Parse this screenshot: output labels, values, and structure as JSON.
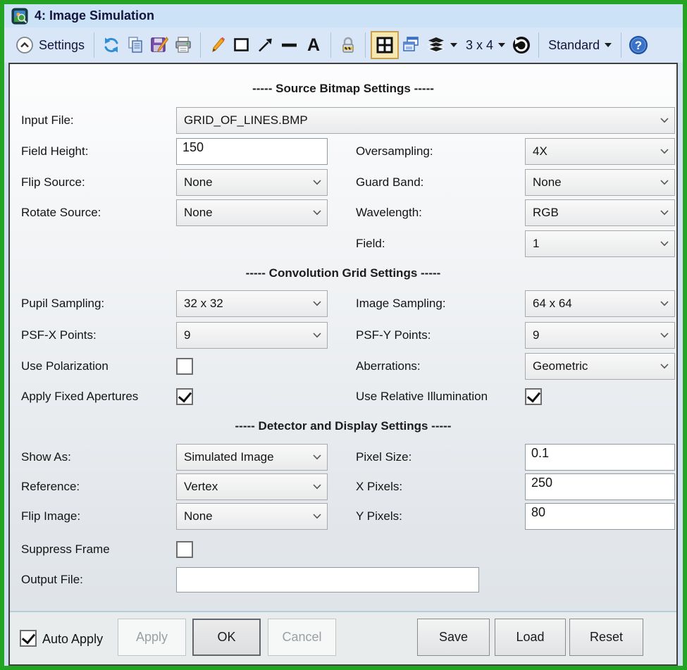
{
  "window": {
    "title": "4: Image Simulation"
  },
  "colors": {
    "frame_green": "#23a423",
    "titlebar_blue": "#cbe2f7",
    "toolbar_blue": "#d8e6f7",
    "active_tool_bg": "#f7e7b0",
    "active_tool_border": "#c9a14c",
    "help_blue": "#3a72c8"
  },
  "toolbar": {
    "settings_label": "Settings",
    "grid_size": "3 x 4",
    "profile": "Standard",
    "text_icon_glyph": "A",
    "help_glyph": "?",
    "icons": [
      "chevron-up-circle",
      "refresh",
      "copy",
      "save",
      "print",
      "pencil",
      "rectangle",
      "arrow",
      "line",
      "text",
      "lock",
      "tile-view",
      "cascade-windows",
      "layers",
      "history",
      "help"
    ]
  },
  "form": {
    "sections": [
      {
        "title": "----- Source Bitmap Settings -----"
      },
      {
        "title": "----- Convolution Grid Settings -----"
      },
      {
        "title": "----- Detector and Display Settings -----"
      }
    ],
    "fields": {
      "input_file": {
        "label": "Input File:",
        "value": "GRID_OF_LINES.BMP"
      },
      "field_height": {
        "label": "Field Height:",
        "value": "150"
      },
      "oversampling": {
        "label": "Oversampling:",
        "value": "4X"
      },
      "flip_source": {
        "label": "Flip Source:",
        "value": "None"
      },
      "guard_band": {
        "label": "Guard Band:",
        "value": "None"
      },
      "rotate_source": {
        "label": "Rotate Source:",
        "value": "None"
      },
      "wavelength": {
        "label": "Wavelength:",
        "value": "RGB"
      },
      "field": {
        "label": "Field:",
        "value": "1"
      },
      "pupil_sampling": {
        "label": "Pupil Sampling:",
        "value": "32 x 32"
      },
      "image_sampling": {
        "label": "Image Sampling:",
        "value": "64 x 64"
      },
      "psf_x_points": {
        "label": "PSF-X Points:",
        "value": "9"
      },
      "psf_y_points": {
        "label": "PSF-Y Points:",
        "value": "9"
      },
      "use_polarization": {
        "label": "Use Polarization",
        "checked": false
      },
      "aberrations": {
        "label": "Aberrations:",
        "value": "Geometric"
      },
      "apply_fixed_apertures": {
        "label": "Apply Fixed Apertures",
        "checked": true
      },
      "use_relative_illumination": {
        "label": "Use Relative Illumination",
        "checked": true
      },
      "show_as": {
        "label": "Show As:",
        "value": "Simulated Image"
      },
      "pixel_size": {
        "label": "Pixel Size:",
        "value": "0.1"
      },
      "reference": {
        "label": "Reference:",
        "value": "Vertex"
      },
      "x_pixels": {
        "label": "X Pixels:",
        "value": "250"
      },
      "flip_image": {
        "label": "Flip Image:",
        "value": "None"
      },
      "y_pixels": {
        "label": "Y Pixels:",
        "value": "80"
      },
      "suppress_frame": {
        "label": "Suppress Frame",
        "checked": false
      },
      "output_file": {
        "label": "Output File:",
        "value": ""
      }
    }
  },
  "footer": {
    "auto_apply": {
      "label": "Auto Apply",
      "checked": true
    },
    "buttons": {
      "apply": {
        "label": "Apply",
        "disabled": true
      },
      "ok": {
        "label": "OK",
        "disabled": false
      },
      "cancel": {
        "label": "Cancel",
        "disabled": true
      },
      "save": {
        "label": "Save",
        "disabled": false
      },
      "load": {
        "label": "Load",
        "disabled": false
      },
      "reset": {
        "label": "Reset",
        "disabled": false
      }
    }
  }
}
